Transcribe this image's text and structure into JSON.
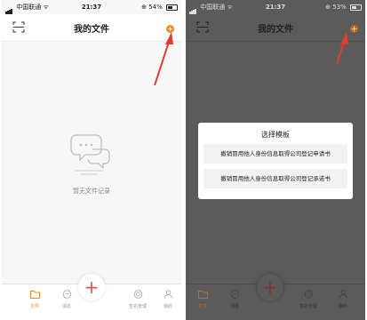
{
  "left": {
    "status": {
      "carrier": "中国联通",
      "time": "21:37",
      "battery": "54%"
    },
    "nav": {
      "title": "我的文件",
      "add_label": "+"
    },
    "empty_text": "暂无文件记录",
    "center_button": "+",
    "tabs": [
      {
        "label": "文件",
        "icon": "folder-icon"
      },
      {
        "label": "消息",
        "icon": "message-icon"
      },
      {
        "label": "签名管理",
        "icon": "signature-icon"
      },
      {
        "label": "我的",
        "icon": "user-icon"
      }
    ]
  },
  "right": {
    "status": {
      "carrier": "中国联通",
      "time": "21:37",
      "battery": "53%"
    },
    "nav": {
      "title": "我的文件",
      "add_label": "+"
    },
    "modal": {
      "title": "选择模板",
      "options": [
        "撤销冒用他人身份信息取得公司登记申请书",
        "撤销冒用他人身份信息取得公司登记承诺书"
      ]
    },
    "center_button": "+",
    "tabs": [
      {
        "label": "文件",
        "icon": "folder-icon"
      },
      {
        "label": "消息",
        "icon": "message-icon"
      },
      {
        "label": "签名管理",
        "icon": "signature-icon"
      },
      {
        "label": "我的",
        "icon": "user-icon"
      }
    ]
  },
  "colors": {
    "accent": "#f08a2c",
    "arrow": "#e53a2e",
    "center_plus": "#e34f42",
    "overlay": "#5b5b5b"
  }
}
